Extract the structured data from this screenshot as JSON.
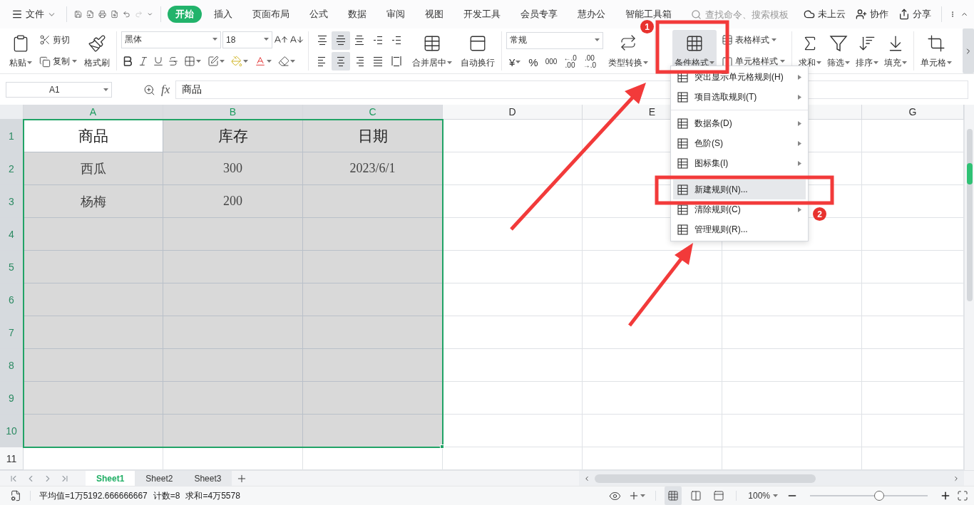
{
  "file_menu": "文件",
  "tabs": [
    {
      "label": "开始",
      "selected": true
    },
    {
      "label": "插入",
      "selected": false
    },
    {
      "label": "页面布局",
      "selected": false
    },
    {
      "label": "公式",
      "selected": false
    },
    {
      "label": "数据",
      "selected": false
    },
    {
      "label": "审阅",
      "selected": false
    },
    {
      "label": "视图",
      "selected": false
    },
    {
      "label": "开发工具",
      "selected": false
    },
    {
      "label": "会员专享",
      "selected": false
    },
    {
      "label": "慧办公",
      "selected": false
    },
    {
      "label": "智能工具箱",
      "selected": false
    }
  ],
  "search": {
    "placeholder": "查找命令、搜索模板"
  },
  "top_actions": [
    {
      "label": "未上云"
    },
    {
      "label": "协作"
    },
    {
      "label": "分享"
    }
  ],
  "ribbon": {
    "paste": "粘贴",
    "cut": "剪切",
    "copy": "复制",
    "format_painter": "格式刷",
    "font_name": "黑体",
    "font_size": "18",
    "align_buttons": [
      {
        "selected": false
      },
      {
        "selected": true
      },
      {
        "selected": false
      },
      {
        "selected": false
      },
      {
        "selected": false
      },
      {
        "selected": false
      },
      {
        "selected": true
      },
      {
        "selected": false
      },
      {
        "selected": false
      },
      {
        "selected": false
      }
    ],
    "merge": "合并居中",
    "wrap": "自动换行",
    "number_format": "常规",
    "currency": "¥",
    "percent": "%",
    "thousands": "000",
    "decimal_buttons": [
      [
        "←.0",
        ".00"
      ],
      [
        ".00",
        "→.0"
      ]
    ],
    "convert": "类型转换",
    "conditional_format": "条件格式",
    "conditional_selected": true,
    "table_style": "表格样式",
    "cell_style": "单元格样式",
    "tools": [
      "求和",
      "筛选",
      "排序",
      "填充",
      "单元格"
    ]
  },
  "name_box": "A1",
  "function_label": "fx",
  "formula": "商品",
  "columns": [
    {
      "label": "A",
      "selected": true
    },
    {
      "label": "B",
      "selected": true
    },
    {
      "label": "C",
      "selected": true
    },
    {
      "label": "D",
      "selected": false
    },
    {
      "label": "E",
      "selected": false
    },
    {
      "selected": false
    },
    {
      "label": "G",
      "selected": false
    }
  ],
  "rows": [
    {
      "label": "1",
      "selected": true,
      "kind": "header",
      "cells": [
        {
          "text": "商品",
          "active": true
        },
        {
          "text": "库存",
          "active": false
        },
        {
          "text": "日期",
          "active": false
        }
      ]
    },
    {
      "label": "2",
      "selected": true,
      "kind": "data",
      "cells": [
        {
          "text": "西瓜",
          "active": false
        },
        {
          "text": "300",
          "active": false
        },
        {
          "text": "2023/6/1",
          "active": false
        }
      ]
    },
    {
      "label": "3",
      "selected": true,
      "kind": "data",
      "cells": [
        {
          "text": "杨梅",
          "active": false
        },
        {
          "text": "200",
          "active": false
        },
        {
          "active": false
        }
      ]
    },
    {
      "label": "4",
      "selected": true,
      "kind": "data"
    },
    {
      "label": "5",
      "selected": true,
      "kind": "data"
    },
    {
      "label": "6",
      "selected": true,
      "kind": "data"
    },
    {
      "label": "7",
      "selected": true,
      "kind": "data"
    },
    {
      "label": "8",
      "selected": true,
      "kind": "data"
    },
    {
      "label": "9",
      "selected": true,
      "kind": "data"
    },
    {
      "label": "10",
      "selected": true,
      "kind": "data"
    },
    {
      "label": "11",
      "selected": false,
      "kind": "data"
    }
  ],
  "context_menu": [
    {
      "label": "突出显示单元格规则(H)",
      "submenu": true,
      "highlighted": false,
      "separator_before": false
    },
    {
      "label": "项目选取规则(T)",
      "submenu": true,
      "highlighted": false,
      "separator_before": false
    },
    {
      "label": "数据条(D)",
      "submenu": true,
      "highlighted": false,
      "separator_before": true
    },
    {
      "label": "色阶(S)",
      "submenu": true,
      "highlighted": false,
      "separator_before": false
    },
    {
      "label": "图标集(I)",
      "submenu": true,
      "highlighted": false,
      "separator_before": false
    },
    {
      "label": "新建规则(N)...",
      "submenu": false,
      "highlighted": true,
      "separator_before": true
    },
    {
      "label": "清除规则(C)",
      "submenu": true,
      "highlighted": false,
      "separator_before": false
    },
    {
      "label": "管理规则(R)...",
      "submenu": false,
      "highlighted": false,
      "separator_before": false
    }
  ],
  "sheets": [
    {
      "label": "Sheet1",
      "selected": true
    },
    {
      "label": "Sheet2",
      "selected": false
    },
    {
      "label": "Sheet3",
      "selected": false
    }
  ],
  "status": [
    "平均值=1万5192.666666667",
    "计数=8",
    "求和=4万5578"
  ],
  "view_modes": [
    {
      "selected": true
    },
    {
      "selected": false
    },
    {
      "selected": false
    }
  ],
  "zoom": {
    "label": "100%",
    "level": 0.59
  },
  "annotations": [
    "1",
    "2"
  ]
}
